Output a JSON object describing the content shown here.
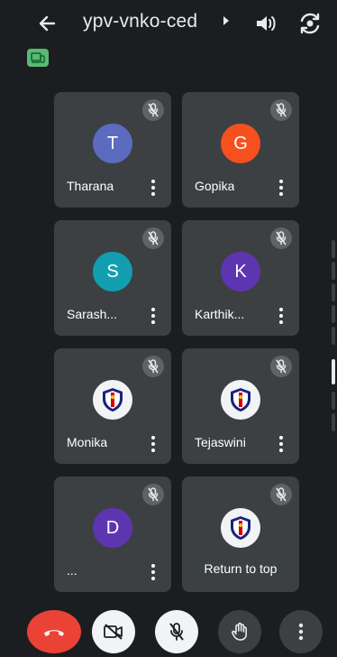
{
  "header": {
    "meeting_code": "ypv-vnko-ced",
    "icons": [
      "back-arrow-icon",
      "caret-right-icon",
      "speaker-icon",
      "switch-camera-icon",
      "devices-badge-icon"
    ]
  },
  "participants": [
    {
      "name": "Tharana",
      "initial": "T",
      "avatar_color": "#5c6bc0",
      "muted": true
    },
    {
      "name": "Gopika",
      "initial": "G",
      "avatar_color": "#f4511e",
      "muted": true
    },
    {
      "name": "Sarash...",
      "initial": "S",
      "avatar_color": "#129eaf",
      "muted": true
    },
    {
      "name": "Karthik...",
      "initial": "K",
      "avatar_color": "#5e35b1",
      "muted": true
    },
    {
      "name": "Monika",
      "initial": "",
      "avatar_color": "#f1f3f4",
      "muted": true,
      "avatar_type": "logo"
    },
    {
      "name": "Tejaswini",
      "initial": "",
      "avatar_color": "#f1f3f4",
      "muted": true,
      "avatar_type": "logo"
    },
    {
      "name": "...",
      "initial": "D",
      "avatar_color": "#5e35b1",
      "muted": true
    },
    {
      "name": "",
      "initial": "",
      "avatar_color": "#f1f3f4",
      "muted": true,
      "avatar_type": "logo"
    }
  ],
  "return_to_top": "Return to top",
  "controls": {
    "end_call": {
      "icon": "end-call-icon",
      "color": "#ea4335"
    },
    "camera": {
      "icon": "camera-off-icon",
      "state": "off"
    },
    "mic": {
      "icon": "mic-off-icon",
      "state": "off"
    },
    "raise_hand": {
      "icon": "raise-hand-icon"
    },
    "more": {
      "icon": "more-options-icon"
    }
  },
  "colors": {
    "background": "#1c1d20",
    "tile": "#3c4043",
    "mic_badge": "#5f6368"
  }
}
